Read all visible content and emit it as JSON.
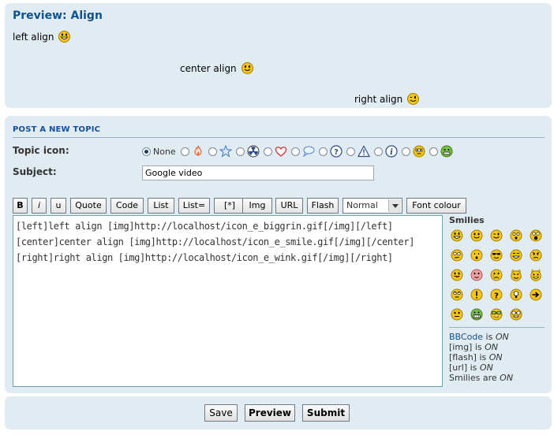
{
  "preview": {
    "title": "Preview: Align",
    "lines": [
      {
        "text": "left align",
        "smiley": "biggrin-smiley-icon"
      },
      {
        "text": "center align",
        "smiley": "smile-smiley-icon"
      },
      {
        "text": "right align",
        "smiley": "wink-smiley-icon"
      }
    ]
  },
  "post": {
    "title": "POST A NEW TOPIC",
    "topic_icon_label": "Topic icon:",
    "none_label": "None",
    "topic_icons": [
      "fire-icon",
      "star-icon",
      "radioactive-icon",
      "heart-icon",
      "speech-bubble-icon",
      "question-icon",
      "warning-icon",
      "info-icon",
      "smiley-icon",
      "grin-icon"
    ],
    "subject_label": "Subject:",
    "subject_value": "Google video",
    "toolbar": {
      "bold": "B",
      "italic": "i",
      "underline": "u",
      "quote": "Quote",
      "code": "Code",
      "list": "List",
      "list_eq": "List=",
      "list_item": "[*]",
      "img": "Img",
      "url": "URL",
      "flash": "Flash",
      "font_size": "Normal",
      "font_colour": "Font colour"
    },
    "message_text": "[left]left align [img]http://localhost/icon_e_biggrin.gif[/img][/left]\n[center]center align [img]http://localhost/icon_e_smile.gif[/img][/center]\n[right]right align [img]http://localhost/icon_e_wink.gif[/img][/right]",
    "smilies_title": "Smilies",
    "status": {
      "bbcode_link": "BBCode",
      "bbcode_rest": " is ",
      "bbcode_state": "ON",
      "img_label": "[img] is ",
      "img_state": "ON",
      "flash_label": "[flash] is ",
      "flash_state": "ON",
      "url_label": "[url] is ",
      "url_state": "ON",
      "smilies_label": "Smilies are ",
      "smilies_state": "ON"
    }
  },
  "buttons": {
    "save": "Save",
    "preview": "Preview",
    "submit": "Submit"
  },
  "colors": {
    "panel_bg": "#e1ebf2",
    "title_blue": "#105289",
    "smiley_yellow": "#f7c520"
  }
}
